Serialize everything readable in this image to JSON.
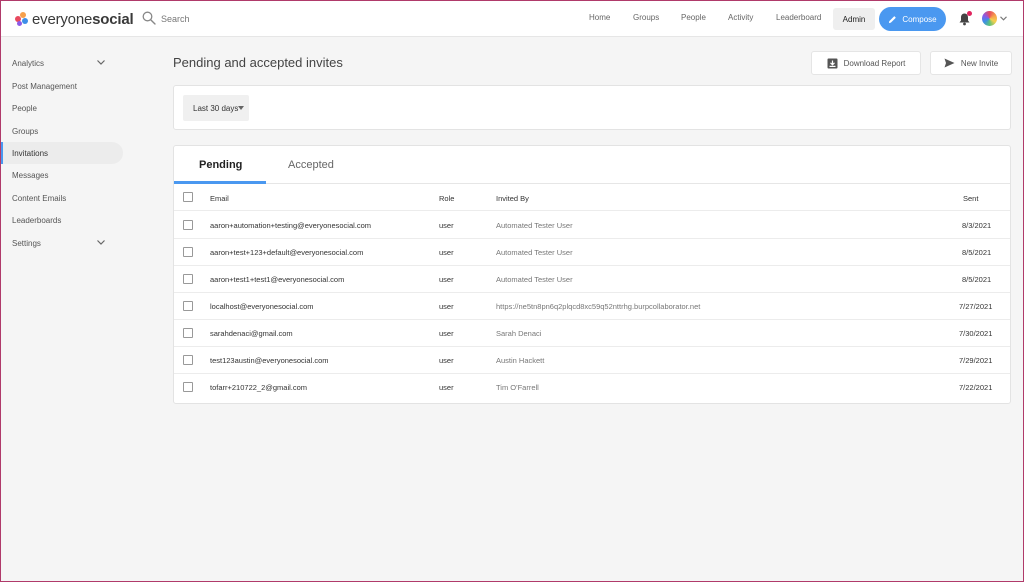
{
  "brand": {
    "name_part1": "everyone",
    "name_part2": "social",
    "colors": [
      "#e84a5f",
      "#f6a04d",
      "#3e8ee8",
      "#8d5be6"
    ]
  },
  "search": {
    "placeholder": "Search"
  },
  "nav": {
    "items": [
      "Home",
      "Groups",
      "People",
      "Activity",
      "Leaderboard"
    ],
    "admin": "Admin",
    "compose": "Compose"
  },
  "sidebar": {
    "items": [
      {
        "label": "Analytics",
        "chevron": true
      },
      {
        "label": "Post Management"
      },
      {
        "label": "People"
      },
      {
        "label": "Groups"
      },
      {
        "label": "Invitations",
        "active": true
      },
      {
        "label": "Messages"
      },
      {
        "label": "Content Emails"
      },
      {
        "label": "Leaderboards"
      },
      {
        "label": "Settings",
        "chevron": true
      }
    ]
  },
  "main": {
    "title": "Pending and accepted invites",
    "download_report": "Download Report",
    "new_invite": "New Invite",
    "filter": {
      "selected": "Last 30 days"
    },
    "tabs": [
      "Pending",
      "Accepted"
    ],
    "active_tab": "Pending"
  },
  "table": {
    "headers": {
      "email": "Email",
      "role": "Role",
      "invited_by": "Invited By",
      "sent": "Sent"
    },
    "rows": [
      {
        "email": "aaron+automation+testing@everyonesocial.com",
        "role": "user",
        "invited_by": "Automated Tester User",
        "sent": "8/3/2021"
      },
      {
        "email": "aaron+test+123+default@everyonesocial.com",
        "role": "user",
        "invited_by": "Automated Tester User",
        "sent": "8/5/2021"
      },
      {
        "email": "aaron+test1+test1@everyonesocial.com",
        "role": "user",
        "invited_by": "Automated Tester User",
        "sent": "8/5/2021"
      },
      {
        "email": "localhost@everyonesocial.com",
        "role": "user",
        "invited_by": "https://ne5tn8pn6q2plqcd8xc59q52nttrhg.burpcollaborator.net",
        "sent": "7/27/2021"
      },
      {
        "email": "sarahdenaci@gmail.com",
        "role": "user",
        "invited_by": "Sarah Denaci",
        "sent": "7/30/2021"
      },
      {
        "email": "test123austin@everyonesocial.com",
        "role": "user",
        "invited_by": "Austin Hackett",
        "sent": "7/29/2021"
      },
      {
        "email": "tofarr+210722_2@gmail.com",
        "role": "user",
        "invited_by": "Tim O'Farrell",
        "sent": "7/22/2021"
      }
    ]
  },
  "colors": {
    "accent": "#4a98f0",
    "notification": "#e0245e"
  }
}
